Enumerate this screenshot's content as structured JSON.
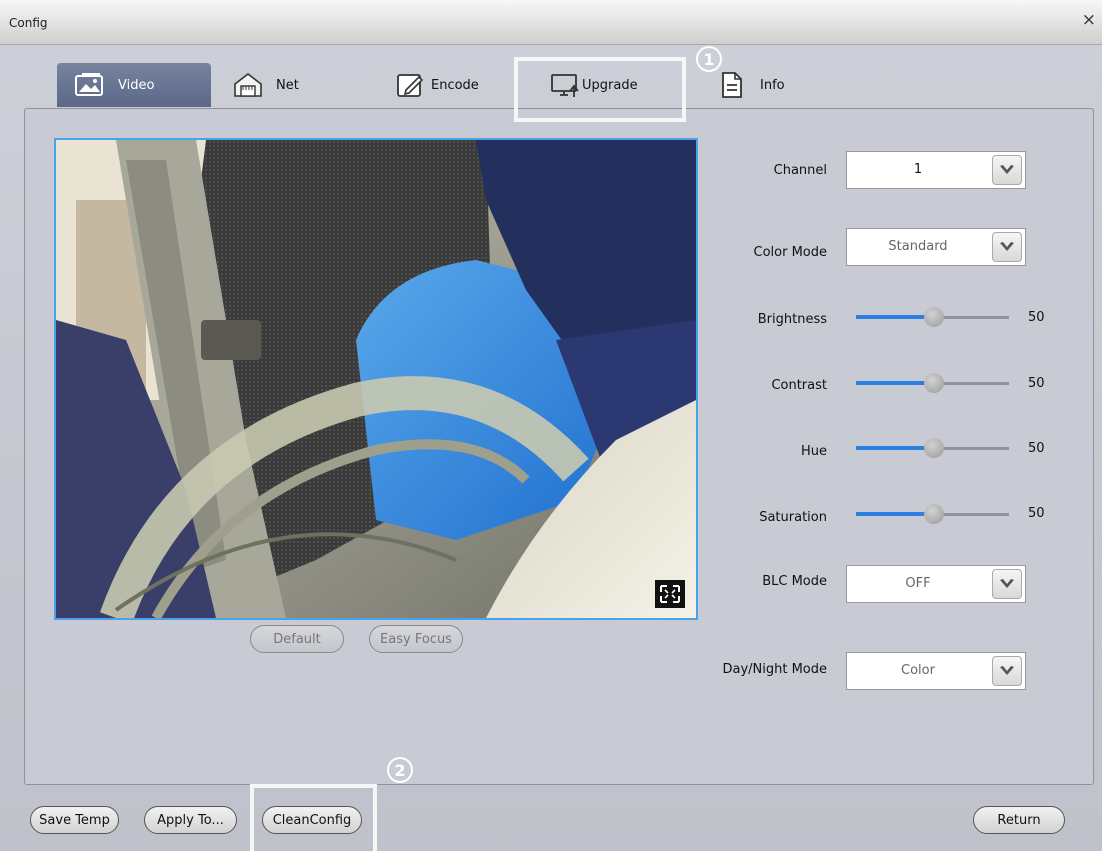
{
  "window": {
    "title": "Config",
    "close_label": "×"
  },
  "tabs": [
    {
      "label": "Video",
      "icon": "picture-icon",
      "active": true
    },
    {
      "label": "Net",
      "icon": "network-icon",
      "active": false
    },
    {
      "label": "Encode",
      "icon": "edit-icon",
      "active": false
    },
    {
      "label": "Upgrade",
      "icon": "monitor-upload-icon",
      "active": false
    },
    {
      "label": "Info",
      "icon": "document-icon",
      "active": false
    }
  ],
  "callouts": {
    "first": "1",
    "second": "2"
  },
  "video_buttons": {
    "default_label": "Default",
    "easy_focus_label": "Easy Focus"
  },
  "settings": {
    "channel": {
      "label": "Channel",
      "value": "1"
    },
    "color_mode": {
      "label": "Color Mode",
      "value": "Standard"
    },
    "brightness": {
      "label": "Brightness",
      "value": 50
    },
    "contrast": {
      "label": "Contrast",
      "value": 50
    },
    "hue": {
      "label": "Hue",
      "value": 50
    },
    "saturation": {
      "label": "Saturation",
      "value": 50
    },
    "blc_mode": {
      "label": "BLC Mode",
      "value": "OFF"
    },
    "day_night_mode": {
      "label": "Day/Night Mode",
      "value": "Color"
    }
  },
  "footer": {
    "save_temp": "Save Temp",
    "apply_to": "Apply To...",
    "clean_config": "CleanConfig",
    "return": "Return"
  },
  "colors": {
    "active_tab": "#66728f",
    "accent_blue": "#2a7fe0",
    "video_border": "#4aa3ea",
    "highlight": "#f6f6f6"
  }
}
